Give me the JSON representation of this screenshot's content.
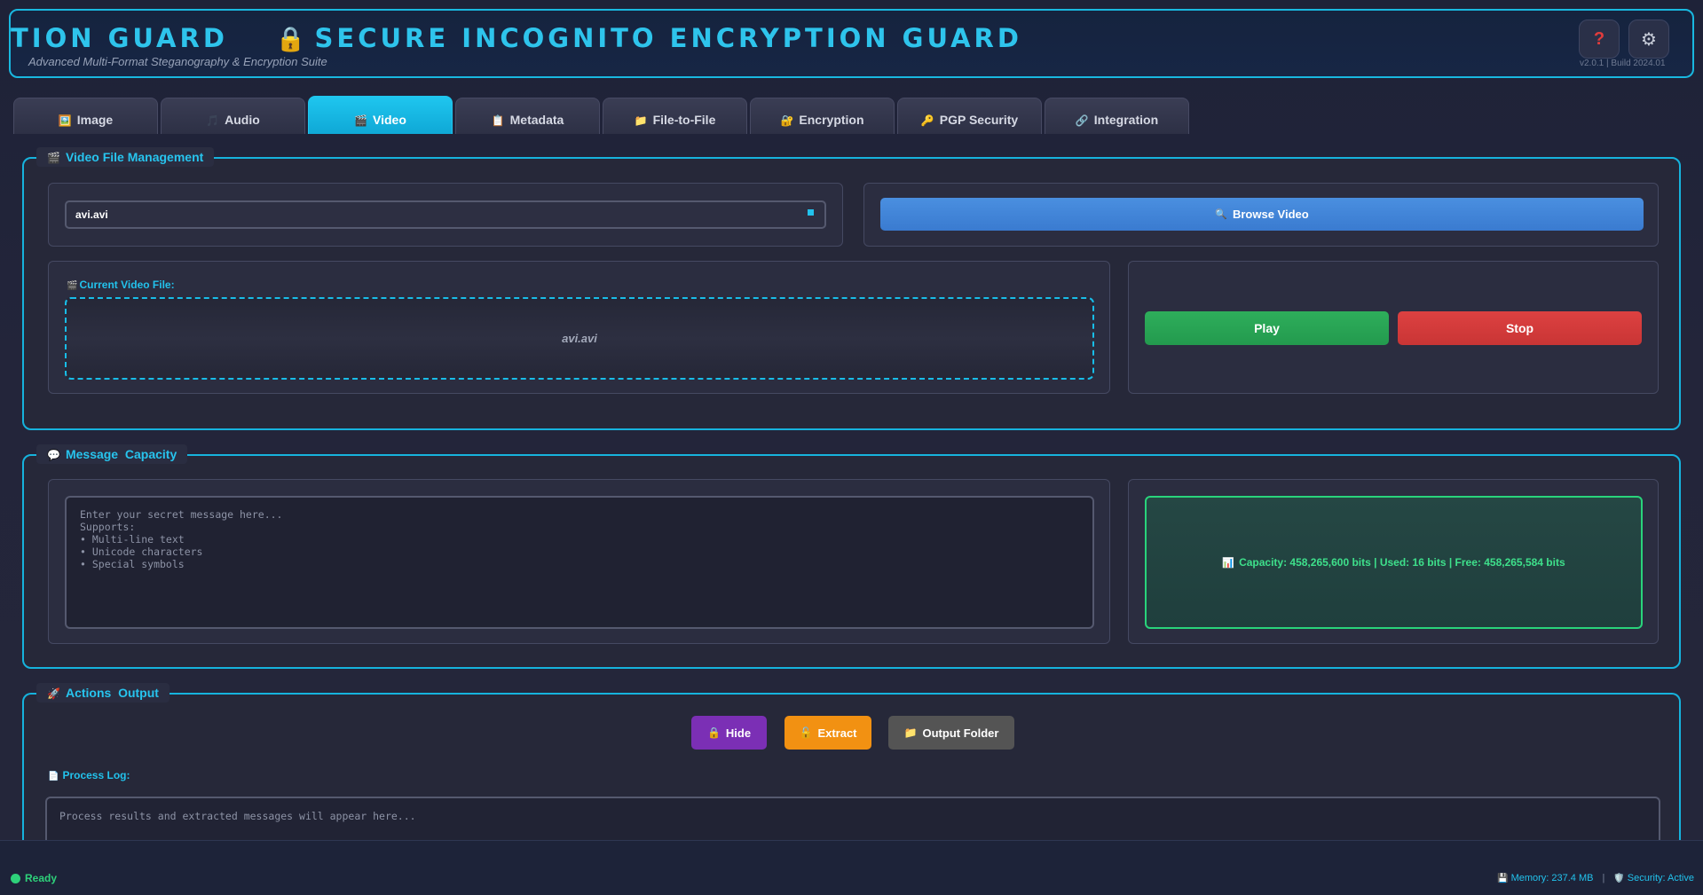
{
  "header": {
    "marquee_start": "TION GUARD",
    "marquee_main": "SECURE INCOGNITO ENCRYPTION GUARD",
    "lock_icon": "🔒",
    "subtitle": "Advanced Multi-Format Steganography & Encryption Suite",
    "help_label": "?",
    "settings_label": "⚙",
    "version": "v2.0.1 | Build 2024.01"
  },
  "tabs": [
    {
      "icon": "🖼️",
      "label": "Image",
      "icon_name": "image-icon"
    },
    {
      "icon": "🎵",
      "label": "Audio",
      "icon_name": "audio-icon"
    },
    {
      "icon": "🎬",
      "label": "Video",
      "icon_name": "video-icon",
      "active": true
    },
    {
      "icon": "📋",
      "label": "Metadata",
      "icon_name": "metadata-icon"
    },
    {
      "icon": "📁",
      "label": "File-to-File",
      "icon_name": "folder-icon"
    },
    {
      "icon": "🔐",
      "label": "Encryption",
      "icon_name": "encryption-icon"
    },
    {
      "icon": "🔑",
      "label": "PGP Security",
      "icon_name": "key-icon"
    },
    {
      "icon": "🔗",
      "label": "Integration",
      "icon_name": "link-icon"
    }
  ],
  "video_section": {
    "legend_icon": "🎬",
    "legend": "Video File Management",
    "file_path": "avi.avi",
    "browse_icon": "🔍",
    "browse_label": "Browse Video",
    "current_icon": "🎬",
    "current_label": "Current Video File:",
    "current_file": "avi.avi",
    "play_label": "Play",
    "stop_label": "Stop"
  },
  "message_section": {
    "legend_icon": "💬",
    "legend": "Message  Capacity",
    "placeholder": "Enter your secret message here...\nSupports:\n• Multi-line text\n• Unicode characters\n• Special symbols",
    "capacity_icon": "📊",
    "capacity_text": "Capacity: 458,265,600 bits | Used: 16 bits | Free: 458,265,584 bits"
  },
  "actions_section": {
    "legend_icon": "🚀",
    "legend": "Actions  Output",
    "hide_icon": "🔒",
    "hide_label": "Hide",
    "extract_icon": "🔓",
    "extract_label": "Extract",
    "folder_icon": "📁",
    "folder_label": "Output Folder",
    "log_icon": "📄",
    "log_label": "Process Log:",
    "log_placeholder": "Process results and extracted messages will appear here..."
  },
  "status": {
    "ready": "Ready",
    "memory_icon": "💾",
    "memory": "Memory: 237.4 MB",
    "separator": "|",
    "security_icon": "🛡️",
    "security": "Security: Active"
  },
  "colors": {
    "accent": "#19b8e0",
    "play": "#2eae5b",
    "stop": "#dd4141",
    "hide": "#7b2fb5",
    "extract": "#f29112",
    "capacity_border": "#29d37b"
  }
}
